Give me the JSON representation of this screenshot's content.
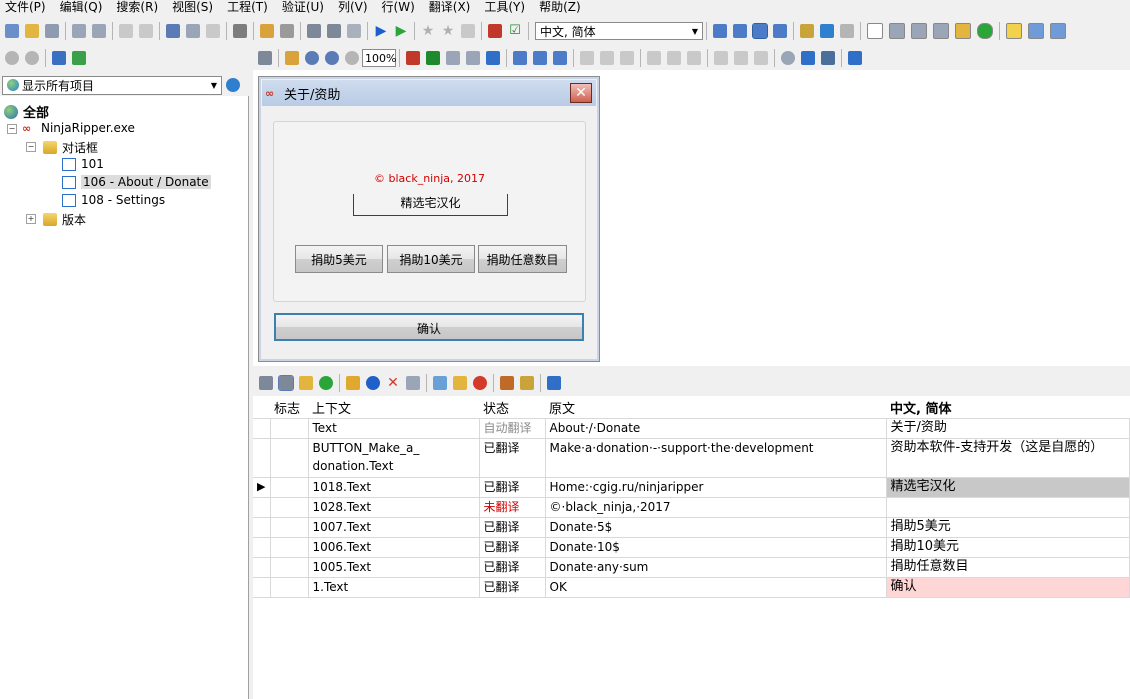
{
  "menu": [
    "文件(P)",
    "编辑(Q)",
    "搜索(R)",
    "视图(S)",
    "工程(T)",
    "验证(U)",
    "列(V)",
    "行(W)",
    "翻译(X)",
    "工具(Y)",
    "帮助(Z)"
  ],
  "toolbar": {
    "language": "中文, 简体"
  },
  "designer_toolbar": {
    "zoom": "100%"
  },
  "filter": {
    "selected": "显示所有项目"
  },
  "tree": {
    "root": "全部",
    "exe": "NinjaRipper.exe",
    "dialogs": "对话框",
    "items": [
      "101",
      "106 - About / Donate",
      "108 - Settings"
    ],
    "version": "版本"
  },
  "dialog": {
    "title": "关于/资助",
    "copyright": "© black_ninja, 2017",
    "homepage": "精选宅汉化",
    "donate5": "捐助5美元",
    "donate10": "捐助10美元",
    "donate_any": "捐助任意数目",
    "ok": "确认"
  },
  "grid": {
    "headers": [
      "标志",
      "上下文",
      "状态",
      "原文",
      "中文, 简体"
    ],
    "rows": [
      {
        "context": "Text",
        "status": "自动翻译",
        "source": "About·/·Donate",
        "target": "关于/资助"
      },
      {
        "context": "BUTTON_Make_a_",
        "context2": "donation.Text",
        "status": "已翻译",
        "source": "Make·a·donation·-·support·the·development",
        "target": "资助本软件-支持开发（这是自愿的）"
      },
      {
        "context": "1018.Text",
        "status": "已翻译",
        "source": "Home:·cgig.ru/ninjaripper",
        "target": "精选宅汉化"
      },
      {
        "context": "1028.Text",
        "status": "未翻译",
        "source": "©·black_ninja,·2017",
        "target": ""
      },
      {
        "context": "1007.Text",
        "status": "已翻译",
        "source": "Donate·5$",
        "target": "捐助5美元"
      },
      {
        "context": "1006.Text",
        "status": "已翻译",
        "source": "Donate·10$",
        "target": "捐助10美元"
      },
      {
        "context": "1005.Text",
        "status": "已翻译",
        "source": "Donate·any·sum",
        "target": "捐助任意数目"
      },
      {
        "context": "1.Text",
        "status": "已翻译",
        "source": "OK",
        "target": "确认"
      }
    ]
  },
  "colors": {
    "untranslated": "#d40000",
    "auto": "#8c8c8c",
    "selected_target": "#c8c8c8",
    "ok_target": "#ffd6d6"
  }
}
